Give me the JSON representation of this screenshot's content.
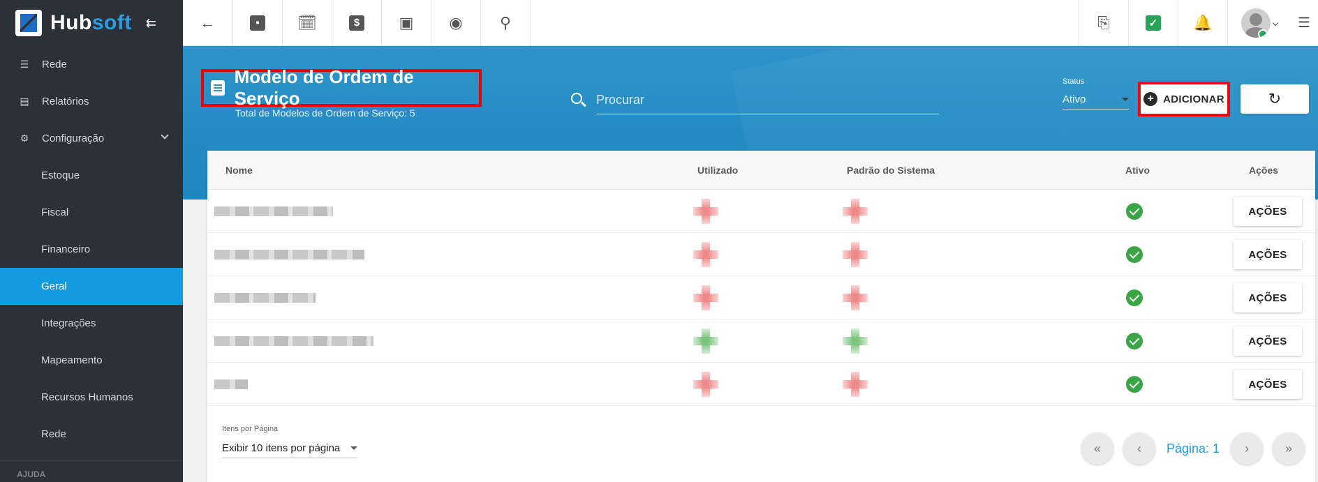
{
  "app": {
    "logo_main": "Hub",
    "logo_accent": "soft"
  },
  "sidebar": {
    "items": [
      {
        "label": "Rede",
        "icon": "server-icon"
      },
      {
        "label": "Relatórios",
        "icon": "document-icon"
      },
      {
        "label": "Configuração",
        "icon": "gear-icon"
      }
    ],
    "subitems": [
      {
        "label": "Estoque"
      },
      {
        "label": "Fiscal"
      },
      {
        "label": "Financeiro"
      },
      {
        "label": "Geral",
        "active": true
      },
      {
        "label": "Integrações"
      },
      {
        "label": "Mapeamento"
      },
      {
        "label": "Recursos Humanos"
      },
      {
        "label": "Rede"
      }
    ],
    "section": "AJUDA"
  },
  "topbar": {
    "left_icons": [
      "back-arrow-icon",
      "contact-card-icon",
      "calendar-clock-icon",
      "dollar-icon",
      "terminal-icon",
      "eye-icon",
      "search-icon"
    ],
    "right_icons": [
      "pdf-icon",
      "chat-check-icon",
      "bell-icon",
      "avatar",
      "list-icon"
    ]
  },
  "header": {
    "title": "Modelo de Ordem de Serviço",
    "subtitle": "Total de Modelos de Ordem de Serviço: 5",
    "search_placeholder": "Procurar",
    "status_label": "Status",
    "status_value": "Ativo",
    "add_label": "ADICIONAR",
    "refresh_icon": "refresh-icon"
  },
  "table": {
    "columns": {
      "nome": "Nome",
      "utilizado": "Utilizado",
      "padrao": "Padrão do Sistema",
      "ativo": "Ativo",
      "acoes": "Ações"
    },
    "rows": [
      {
        "utilizado": "red",
        "padrao": "red",
        "ativo": true,
        "action": "AÇÕES"
      },
      {
        "utilizado": "red",
        "padrao": "red",
        "ativo": true,
        "action": "AÇÕES"
      },
      {
        "utilizado": "red",
        "padrao": "red",
        "ativo": true,
        "action": "AÇÕES"
      },
      {
        "utilizado": "green",
        "padrao": "green",
        "ativo": true,
        "action": "AÇÕES"
      },
      {
        "utilizado": "red",
        "padrao": "red",
        "ativo": true,
        "action": "AÇÕES"
      }
    ]
  },
  "footer": {
    "per_page_label": "Itens por Página",
    "per_page_value": "Exibir 10 itens por página",
    "page_label": "Página: 1"
  },
  "colors": {
    "sidebar_bg": "#2c3138",
    "accent": "#129be0",
    "header_band": "#2d95c9",
    "highlight_border": "#ee0000",
    "check": "#3aa544"
  }
}
